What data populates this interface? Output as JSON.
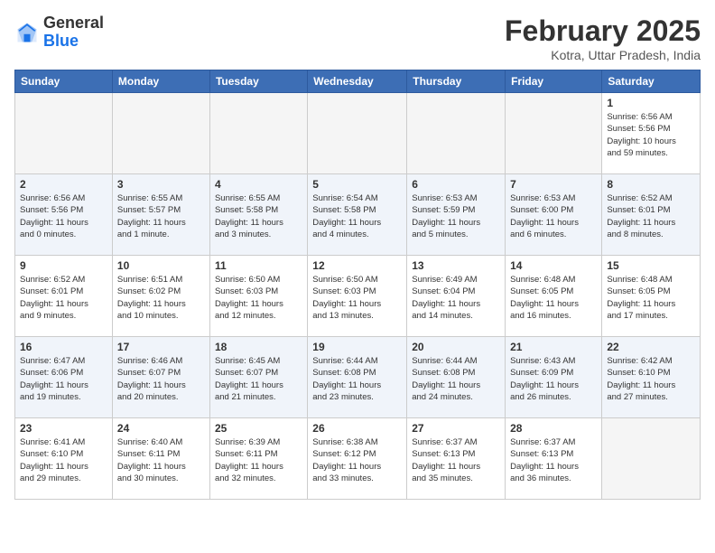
{
  "header": {
    "logo_general": "General",
    "logo_blue": "Blue",
    "month_title": "February 2025",
    "location": "Kotra, Uttar Pradesh, India"
  },
  "days_of_week": [
    "Sunday",
    "Monday",
    "Tuesday",
    "Wednesday",
    "Thursday",
    "Friday",
    "Saturday"
  ],
  "weeks": [
    {
      "days": [
        {
          "num": "",
          "data": ""
        },
        {
          "num": "",
          "data": ""
        },
        {
          "num": "",
          "data": ""
        },
        {
          "num": "",
          "data": ""
        },
        {
          "num": "",
          "data": ""
        },
        {
          "num": "",
          "data": ""
        },
        {
          "num": "1",
          "data": "Sunrise: 6:56 AM\nSunset: 5:56 PM\nDaylight: 10 hours\nand 59 minutes."
        }
      ]
    },
    {
      "days": [
        {
          "num": "2",
          "data": "Sunrise: 6:56 AM\nSunset: 5:56 PM\nDaylight: 11 hours\nand 0 minutes."
        },
        {
          "num": "3",
          "data": "Sunrise: 6:55 AM\nSunset: 5:57 PM\nDaylight: 11 hours\nand 1 minute."
        },
        {
          "num": "4",
          "data": "Sunrise: 6:55 AM\nSunset: 5:58 PM\nDaylight: 11 hours\nand 3 minutes."
        },
        {
          "num": "5",
          "data": "Sunrise: 6:54 AM\nSunset: 5:58 PM\nDaylight: 11 hours\nand 4 minutes."
        },
        {
          "num": "6",
          "data": "Sunrise: 6:53 AM\nSunset: 5:59 PM\nDaylight: 11 hours\nand 5 minutes."
        },
        {
          "num": "7",
          "data": "Sunrise: 6:53 AM\nSunset: 6:00 PM\nDaylight: 11 hours\nand 6 minutes."
        },
        {
          "num": "8",
          "data": "Sunrise: 6:52 AM\nSunset: 6:01 PM\nDaylight: 11 hours\nand 8 minutes."
        }
      ]
    },
    {
      "days": [
        {
          "num": "9",
          "data": "Sunrise: 6:52 AM\nSunset: 6:01 PM\nDaylight: 11 hours\nand 9 minutes."
        },
        {
          "num": "10",
          "data": "Sunrise: 6:51 AM\nSunset: 6:02 PM\nDaylight: 11 hours\nand 10 minutes."
        },
        {
          "num": "11",
          "data": "Sunrise: 6:50 AM\nSunset: 6:03 PM\nDaylight: 11 hours\nand 12 minutes."
        },
        {
          "num": "12",
          "data": "Sunrise: 6:50 AM\nSunset: 6:03 PM\nDaylight: 11 hours\nand 13 minutes."
        },
        {
          "num": "13",
          "data": "Sunrise: 6:49 AM\nSunset: 6:04 PM\nDaylight: 11 hours\nand 14 minutes."
        },
        {
          "num": "14",
          "data": "Sunrise: 6:48 AM\nSunset: 6:05 PM\nDaylight: 11 hours\nand 16 minutes."
        },
        {
          "num": "15",
          "data": "Sunrise: 6:48 AM\nSunset: 6:05 PM\nDaylight: 11 hours\nand 17 minutes."
        }
      ]
    },
    {
      "days": [
        {
          "num": "16",
          "data": "Sunrise: 6:47 AM\nSunset: 6:06 PM\nDaylight: 11 hours\nand 19 minutes."
        },
        {
          "num": "17",
          "data": "Sunrise: 6:46 AM\nSunset: 6:07 PM\nDaylight: 11 hours\nand 20 minutes."
        },
        {
          "num": "18",
          "data": "Sunrise: 6:45 AM\nSunset: 6:07 PM\nDaylight: 11 hours\nand 21 minutes."
        },
        {
          "num": "19",
          "data": "Sunrise: 6:44 AM\nSunset: 6:08 PM\nDaylight: 11 hours\nand 23 minutes."
        },
        {
          "num": "20",
          "data": "Sunrise: 6:44 AM\nSunset: 6:08 PM\nDaylight: 11 hours\nand 24 minutes."
        },
        {
          "num": "21",
          "data": "Sunrise: 6:43 AM\nSunset: 6:09 PM\nDaylight: 11 hours\nand 26 minutes."
        },
        {
          "num": "22",
          "data": "Sunrise: 6:42 AM\nSunset: 6:10 PM\nDaylight: 11 hours\nand 27 minutes."
        }
      ]
    },
    {
      "days": [
        {
          "num": "23",
          "data": "Sunrise: 6:41 AM\nSunset: 6:10 PM\nDaylight: 11 hours\nand 29 minutes."
        },
        {
          "num": "24",
          "data": "Sunrise: 6:40 AM\nSunset: 6:11 PM\nDaylight: 11 hours\nand 30 minutes."
        },
        {
          "num": "25",
          "data": "Sunrise: 6:39 AM\nSunset: 6:11 PM\nDaylight: 11 hours\nand 32 minutes."
        },
        {
          "num": "26",
          "data": "Sunrise: 6:38 AM\nSunset: 6:12 PM\nDaylight: 11 hours\nand 33 minutes."
        },
        {
          "num": "27",
          "data": "Sunrise: 6:37 AM\nSunset: 6:13 PM\nDaylight: 11 hours\nand 35 minutes."
        },
        {
          "num": "28",
          "data": "Sunrise: 6:37 AM\nSunset: 6:13 PM\nDaylight: 11 hours\nand 36 minutes."
        },
        {
          "num": "",
          "data": ""
        }
      ]
    }
  ]
}
